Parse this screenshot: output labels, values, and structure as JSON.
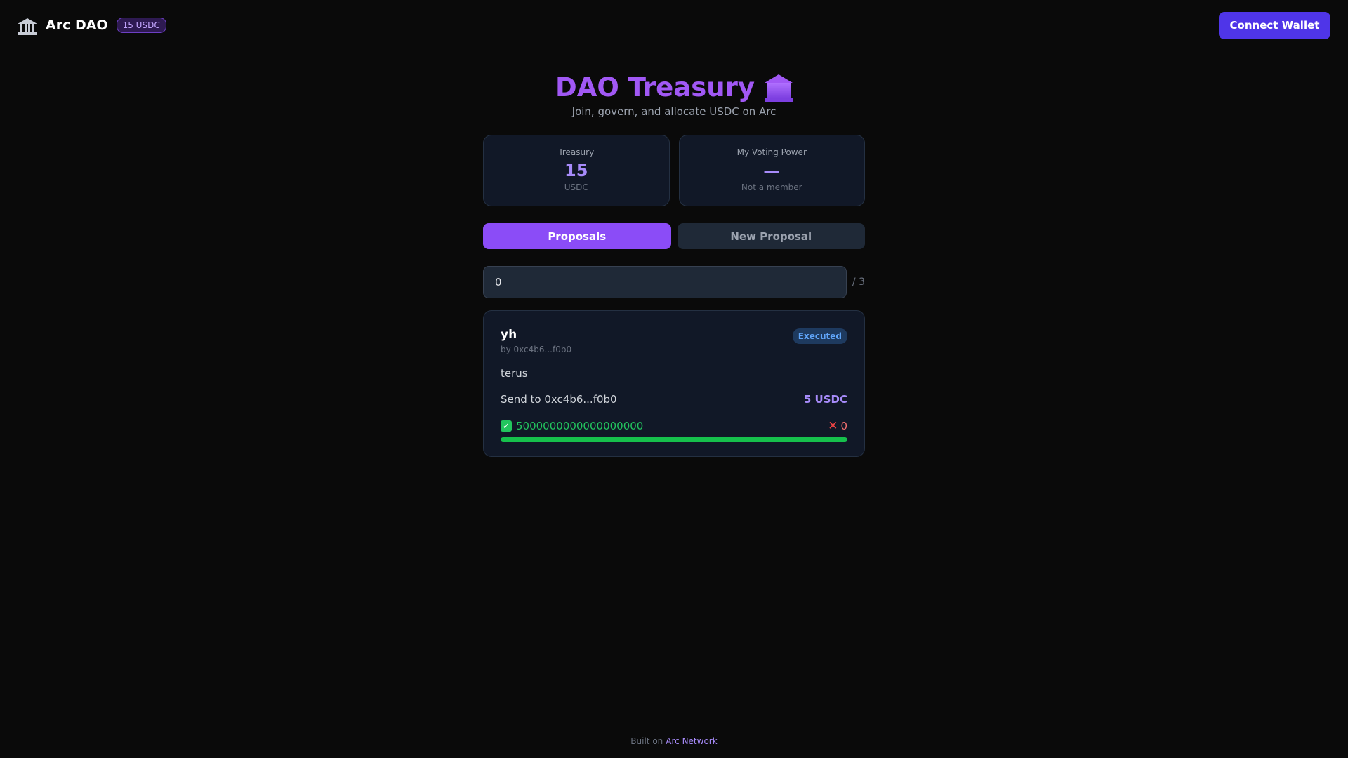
{
  "header": {
    "app_name": "Arc DAO",
    "balance_badge": "15 USDC",
    "connect_label": "Connect Wallet",
    "logo_icon": "bank-building-icon"
  },
  "hero": {
    "title": "DAO Treasury",
    "title_icon": "bank-building-icon",
    "subtitle": "Join, govern, and allocate USDC on Arc"
  },
  "stats": {
    "treasury": {
      "label": "Treasury",
      "value": "15",
      "unit": "USDC"
    },
    "voting_power": {
      "label": "My Voting Power",
      "value": "—",
      "sub": "Not a member"
    }
  },
  "tabs": {
    "proposals_label": "Proposals",
    "new_proposal_label": "New Proposal",
    "active": "Proposals"
  },
  "search": {
    "value": "0",
    "total": "/ 3"
  },
  "proposal": {
    "title": "yh",
    "author": "by 0xc4b6...f0b0",
    "status": "Executed",
    "description": "terus",
    "recipient": "Send to 0xc4b6...f0b0",
    "amount": "5 USDC",
    "votes_for": "5000000000000000000",
    "votes_against": "0",
    "for_fraction": 1.0
  },
  "footer": {
    "prefix": "Built on",
    "link_label": "Arc Network"
  },
  "colors": {
    "background": "#0a0a0a",
    "accent": "#8b4cf7",
    "title": "#a158f5",
    "connect_button": "#4f35e8",
    "vote_for": "#22c55e",
    "vote_against": "#f87171",
    "status_executed": "#60a5fa"
  }
}
